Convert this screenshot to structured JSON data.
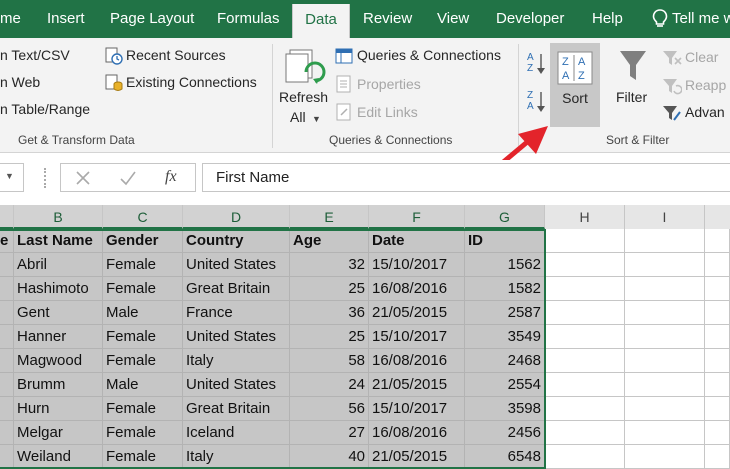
{
  "tabs": [
    "me",
    "Insert",
    "Page Layout",
    "Formulas",
    "Data",
    "Review",
    "View",
    "Developer",
    "Help",
    "Tell me w"
  ],
  "get_transform": {
    "from_text": "n Text/CSV",
    "from_web": "n Web",
    "from_table": "n Table/Range",
    "recent_sources": "Recent Sources",
    "existing_connections": "Existing Connections",
    "group_label": "Get & Transform Data"
  },
  "queries": {
    "refresh_line1": "Refresh",
    "refresh_line2": "All",
    "queries_connections": "Queries & Connections",
    "properties": "Properties",
    "edit_links": "Edit Links",
    "group_label": "Queries & Connections"
  },
  "sort_filter": {
    "sort": "Sort",
    "filter": "Filter",
    "clear": "Clear",
    "reapply": "Reapp",
    "advanced": "Advan",
    "group_label": "Sort & Filter",
    "sort_az_top": "A",
    "sort_az_bottom": "Z",
    "sort_za_top": "Z",
    "sort_za_bottom": "A"
  },
  "formula_bar": {
    "fx": "fx",
    "value": "First Name"
  },
  "columns": [
    "B",
    "C",
    "D",
    "E",
    "F",
    "G",
    "H",
    "I"
  ],
  "headers": [
    "e",
    "Last Name",
    "Gender",
    "Country",
    "Age",
    "Date",
    "ID"
  ],
  "rows": [
    [
      "Abril",
      "Female",
      "United States",
      "32",
      "15/10/2017",
      "1562"
    ],
    [
      "Hashimoto",
      "Female",
      "Great Britain",
      "25",
      "16/08/2016",
      "1582"
    ],
    [
      "Gent",
      "Male",
      "France",
      "36",
      "21/05/2015",
      "2587"
    ],
    [
      "Hanner",
      "Female",
      "United States",
      "25",
      "15/10/2017",
      "3549"
    ],
    [
      "Magwood",
      "Female",
      "Italy",
      "58",
      "16/08/2016",
      "2468"
    ],
    [
      "Brumm",
      "Male",
      "United States",
      "24",
      "21/05/2015",
      "2554"
    ],
    [
      "Hurn",
      "Female",
      "Great Britain",
      "56",
      "15/10/2017",
      "3598"
    ],
    [
      "Melgar",
      "Female",
      "Iceland",
      "27",
      "16/08/2016",
      "2456"
    ],
    [
      "Weiland",
      "Female",
      "Italy",
      "40",
      "21/05/2015",
      "6548"
    ]
  ],
  "colors": {
    "excel_green": "#217346",
    "arrow_red": "#e3242b",
    "selection_gray": "#c6c6c6"
  }
}
